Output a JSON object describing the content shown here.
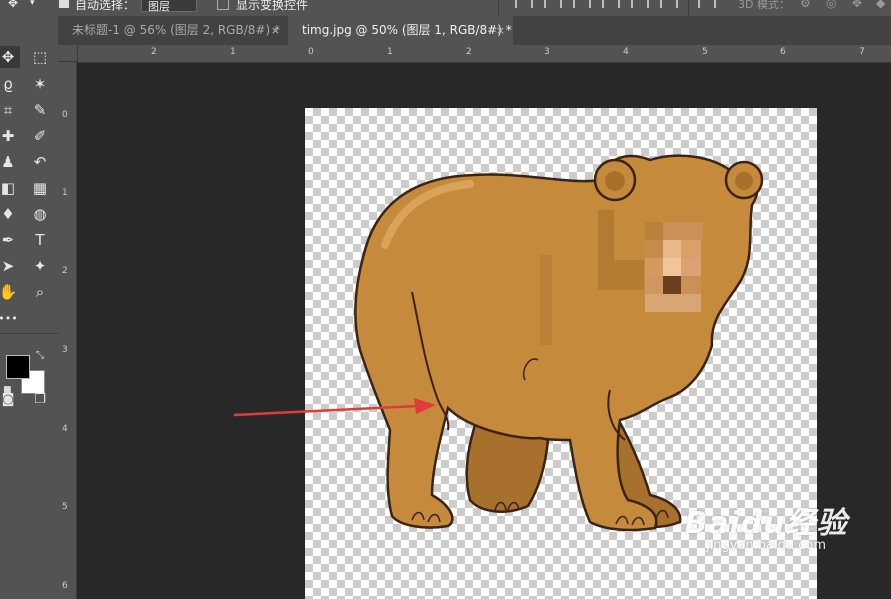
{
  "options_bar": {
    "auto_select_label": "自动选择：",
    "layer_select_value": "图层",
    "show_transform_label": "显示变换控件",
    "mode_3d_label": "3D 模式："
  },
  "tabs": [
    {
      "label": "未标题-1 @ 56% (图层 2, RGB/8#) *",
      "close": "×",
      "active": false
    },
    {
      "label": "timg.jpg @ 50% (图层 1, RGB/8#) *",
      "close": "×",
      "active": true
    }
  ],
  "rulers": {
    "horizontal": [
      "2",
      "1",
      "0",
      "1",
      "2",
      "3",
      "4",
      "5",
      "6",
      "7"
    ],
    "vertical": [
      "0",
      "1",
      "2",
      "3",
      "4",
      "5",
      "6"
    ]
  },
  "tools": {
    "type_glyph": "T",
    "more_glyph": "•••"
  },
  "colors": {
    "foreground": "#000000",
    "background": "#ffffff",
    "arrow": "#e03a3a",
    "bear_fur": "#c58a3c",
    "bear_shadow": "#a7702d",
    "bear_outline": "#3b2414"
  },
  "watermark": {
    "main": "Baidu经验",
    "sub": "jingyan.baidu.com"
  }
}
